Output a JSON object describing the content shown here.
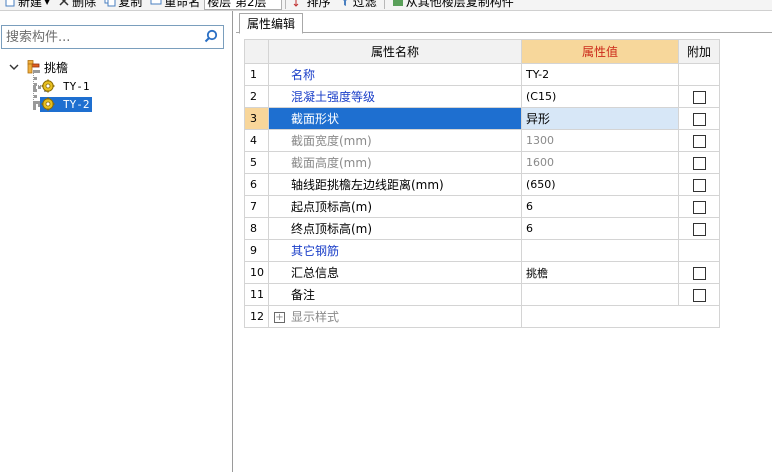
{
  "toolbar": {
    "items": [
      {
        "label": "新建",
        "icon": "new-file-icon",
        "has_dropdown": true
      },
      {
        "label": "删除",
        "icon": "delete-icon"
      },
      {
        "label": "复制",
        "icon": "copy-icon"
      },
      {
        "label": "重命名",
        "icon": "rename-icon"
      }
    ],
    "floor_select": "楼层 第2层",
    "sort_label": "排序",
    "filter_label": "过滤",
    "copy_from_floor_label": "从其他楼层复制构件"
  },
  "search": {
    "placeholder": "搜索构件..."
  },
  "tree": {
    "root_label": "挑檐",
    "children": [
      {
        "label": "TY-1",
        "selected": false
      },
      {
        "label": "TY-2",
        "selected": true
      }
    ]
  },
  "property_tab": {
    "label": "属性编辑"
  },
  "grid": {
    "headers": {
      "name": "属性名称",
      "value": "属性值",
      "extra": "附加"
    },
    "rows": [
      {
        "num": "1",
        "name": "名称",
        "value": "TY-2",
        "checkbox": false,
        "style": "blue"
      },
      {
        "num": "2",
        "name": "混凝土强度等级",
        "value": "(C15)",
        "checkbox": true,
        "style": "blue"
      },
      {
        "num": "3",
        "name": "截面形状",
        "value": "异形",
        "checkbox": true,
        "style": "selected"
      },
      {
        "num": "4",
        "name": "截面宽度(mm)",
        "value": "1300",
        "checkbox": true,
        "style": "gray"
      },
      {
        "num": "5",
        "name": "截面高度(mm)",
        "value": "1600",
        "checkbox": true,
        "style": "gray"
      },
      {
        "num": "6",
        "name": "轴线距挑檐左边线距离(mm)",
        "value": "(650)",
        "checkbox": true,
        "style": "normal"
      },
      {
        "num": "7",
        "name": "起点顶标高(m)",
        "value": "6",
        "checkbox": true,
        "style": "normal"
      },
      {
        "num": "8",
        "name": "终点顶标高(m)",
        "value": "6",
        "checkbox": true,
        "style": "normal"
      },
      {
        "num": "9",
        "name": "其它钢筋",
        "value": "",
        "checkbox": false,
        "style": "blue"
      },
      {
        "num": "10",
        "name": "汇总信息",
        "value": "挑檐",
        "checkbox": true,
        "style": "normal"
      },
      {
        "num": "11",
        "name": "备注",
        "value": "",
        "checkbox": true,
        "style": "normal"
      },
      {
        "num": "12",
        "name": "显示样式",
        "value": "",
        "checkbox": false,
        "style": "group"
      }
    ]
  },
  "colors": {
    "selection_blue": "#1e6fd0",
    "header_orange": "#f7d79b",
    "header_red_text": "#cc2a1a",
    "label_blue": "#1a3ec8",
    "disabled_gray": "#8a8a8a"
  }
}
